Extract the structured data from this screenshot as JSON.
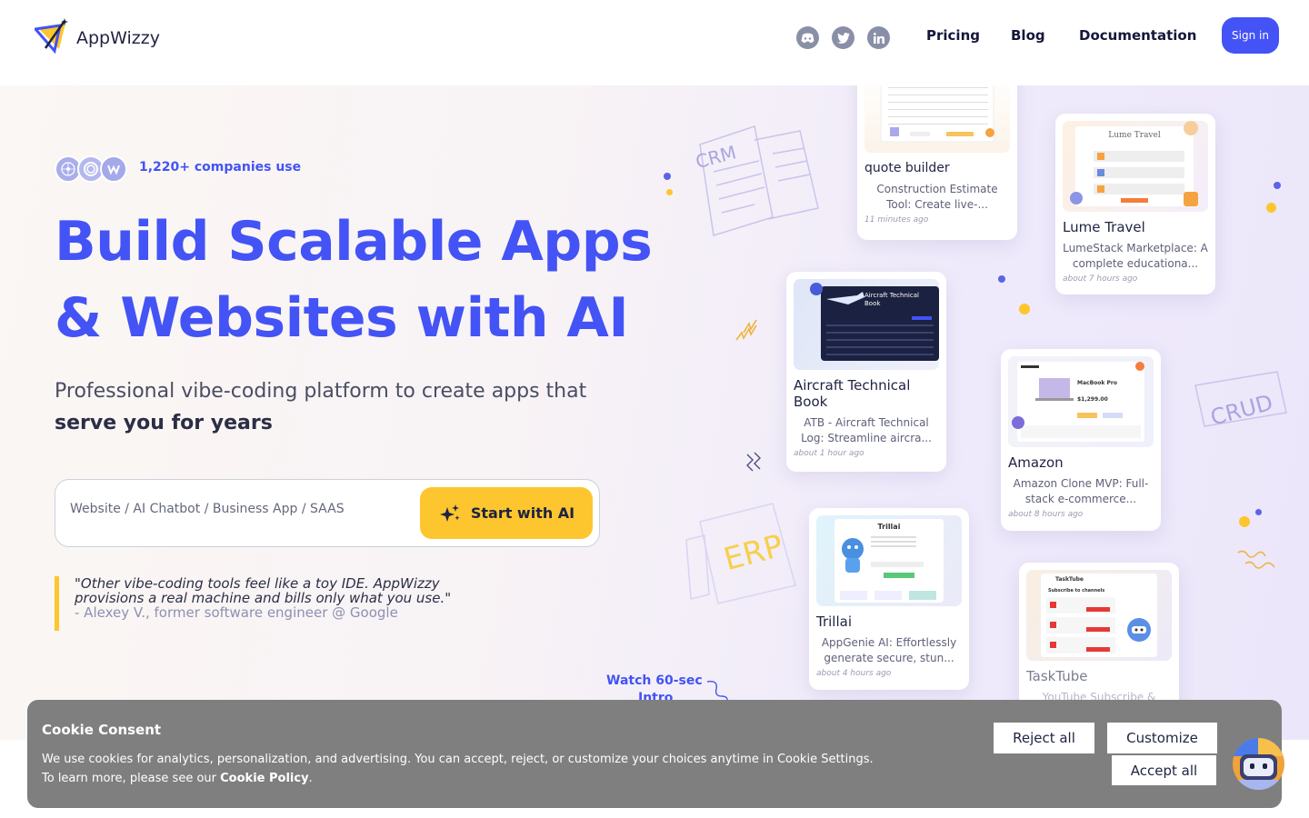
{
  "header": {
    "logo_text": "AppWizzy",
    "social": [
      "discord-icon",
      "twitter-icon",
      "linkedin-icon"
    ],
    "nav": [
      "Pricing",
      "Blog",
      "Documentation"
    ],
    "signin_label": "Sign in"
  },
  "hero": {
    "companies": "1,220+ companies use",
    "title_line1": "Build Scalable Apps",
    "title_line2": "& Websites with AI",
    "subtitle": "Professional vibe-coding platform to create apps that",
    "subtitle_bold": "serve you for years",
    "prompt_placeholder": "Website / AI Chatbot / Business App / SAAS",
    "start_label": "Start with AI",
    "quote_line1": "\"Other vibe-coding tools feel like a toy IDE. AppWizzy",
    "quote_line2": "provisions a real machine and bills only what you use.\"",
    "quote_author": "- Alexey V., former software engineer @ Google",
    "watch_line1": "Watch 60-sec",
    "watch_line2": "Intro"
  },
  "decorations": {
    "crm": "CRM",
    "crud": "CRUD",
    "erp": "ERP"
  },
  "cards": [
    {
      "title": "quote builder",
      "desc": "Construction Estimate Tool: Create live-...",
      "time": "11 minutes ago"
    },
    {
      "title": "Lume Travel",
      "desc": "LumeStack Marketplace: A complete educationa...",
      "time": "about 7 hours ago",
      "thumb_title": "Lume Travel"
    },
    {
      "title": "Aircraft Technical Book",
      "desc": "ATB - Aircraft Technical Log: Streamline aircra...",
      "time": "about 1 hour ago",
      "thumb_title": "Aircraft Technical Book"
    },
    {
      "title": "Amazon",
      "desc": "Amazon Clone MVP: Full-stack e-commerce...",
      "time": "about 8 hours ago",
      "thumb_title": "MacBook Pro",
      "thumb_price": "$1,299.00"
    },
    {
      "title": "Trillai",
      "desc": "AppGenie AI: Effortlessly generate secure, stun...",
      "time": "about 4 hours ago",
      "thumb_title": "Trillai"
    },
    {
      "title": "TaskTube",
      "desc": "YouTube Subscribe &",
      "time": "",
      "thumb_title": "TaskTube",
      "thumb_subtitle": "Subscribe to channels"
    }
  ],
  "cookie": {
    "title": "Cookie Consent",
    "text": "We use cookies for analytics, personalization, and advertising. You can accept, reject, or customize your choices anytime in Cookie Settings. To learn more, please see our",
    "policy_link": "Cookie Policy",
    "reject_label": "Reject all",
    "customize_label": "Customize",
    "accept_label": "Accept all"
  },
  "colors": {
    "brand": "#4353f5",
    "accent": "#fdc62e"
  }
}
